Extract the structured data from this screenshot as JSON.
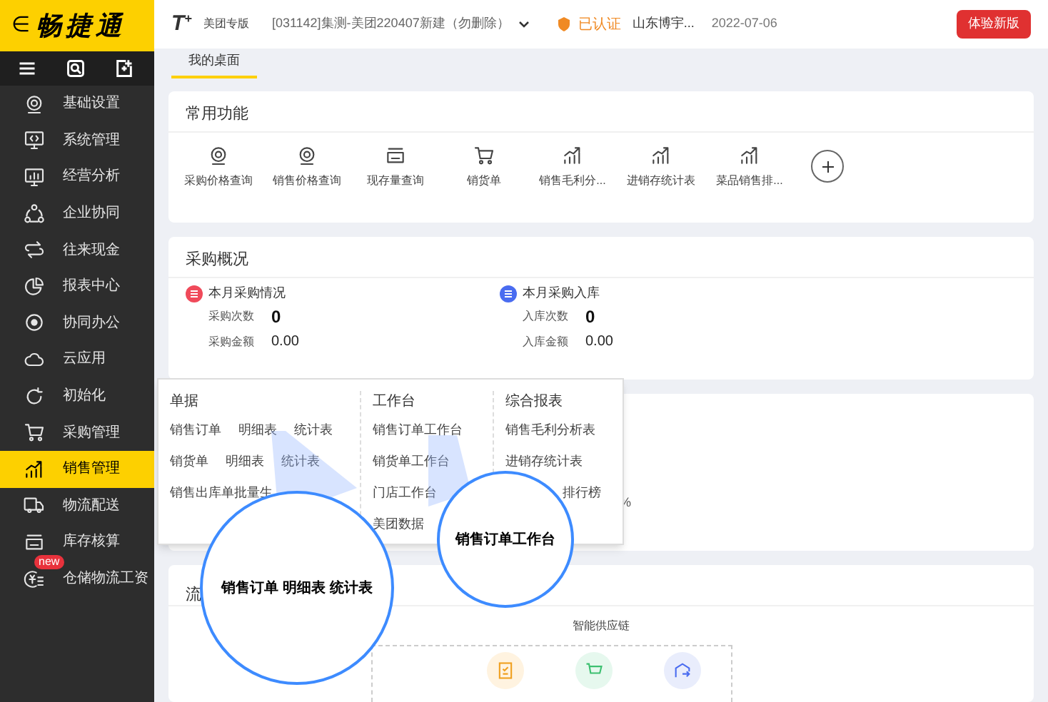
{
  "brand": {
    "arrow": "∈",
    "name": "畅捷通"
  },
  "sidebar": {
    "items": [
      {
        "label": "基础设置",
        "selected": false
      },
      {
        "label": "系统管理",
        "selected": false
      },
      {
        "label": "经营分析",
        "selected": false
      },
      {
        "label": "企业协同",
        "selected": false
      },
      {
        "label": "往来现金",
        "selected": false
      },
      {
        "label": "报表中心",
        "selected": false
      },
      {
        "label": "协同办公",
        "selected": false
      },
      {
        "label": "云应用",
        "selected": false
      },
      {
        "label": "初始化",
        "selected": false
      },
      {
        "label": "采购管理",
        "selected": false
      },
      {
        "label": "销售管理",
        "selected": true
      },
      {
        "label": "物流配送",
        "selected": false
      },
      {
        "label": "库存核算",
        "selected": false
      },
      {
        "label": "仓储物流工资",
        "selected": false,
        "badge": "new"
      }
    ]
  },
  "topbar": {
    "logo": "T",
    "logo_mark": "+",
    "product": "美团专版",
    "account": "[031142]集测-美团220407新建（勿删除）",
    "verified": "已认证",
    "company": "山东博宇...",
    "date": "2022-07-06",
    "try_button": "体验新版"
  },
  "tabs": [
    {
      "label": "我的桌面",
      "selected": true
    }
  ],
  "common_functions": {
    "title": "常用功能",
    "items": [
      {
        "label": "采购价格查询"
      },
      {
        "label": "销售价格查询"
      },
      {
        "label": "现存量查询"
      },
      {
        "label": "销货单"
      },
      {
        "label": "销售毛利分..."
      },
      {
        "label": "进销存统计表"
      },
      {
        "label": "菜品销售排..."
      }
    ]
  },
  "purchase_overview": {
    "title": "采购概况",
    "groups": [
      {
        "title": "本月采购情况",
        "color": "#f04a5a",
        "rows": [
          {
            "label": "采购次数",
            "value": "0"
          },
          {
            "label": "采购金额",
            "value": "0.00"
          }
        ]
      },
      {
        "title": "本月采购入库",
        "color": "#4a6cf0",
        "rows": [
          {
            "label": "入库次数",
            "value": "0"
          },
          {
            "label": "入库金额",
            "value": "0.00"
          }
        ]
      }
    ]
  },
  "hidden_card": {
    "percent": "%"
  },
  "menu": {
    "columns": [
      {
        "title": "单据",
        "rows": [
          [
            "销售订单",
            "明细表",
            "统计表"
          ],
          [
            "销货单",
            "明细表",
            "统计表"
          ],
          [
            "销售出库单批量生"
          ]
        ]
      },
      {
        "title": "工作台",
        "rows": [
          [
            "销售订单工作台"
          ],
          [
            "销货单工作台"
          ],
          [
            "门店工作台"
          ],
          [
            "美团数据"
          ]
        ]
      },
      {
        "title": "综合报表",
        "rows": [
          [
            "销售毛利分析表"
          ],
          [
            "进销存统计表"
          ],
          [
            "排行榜"
          ]
        ]
      }
    ]
  },
  "flow_card": {
    "title": "流",
    "section": "智能供应链"
  },
  "magnifiers": [
    {
      "text": "销售订单 明细表 统计表"
    },
    {
      "text": "销售订单工作台"
    }
  ]
}
